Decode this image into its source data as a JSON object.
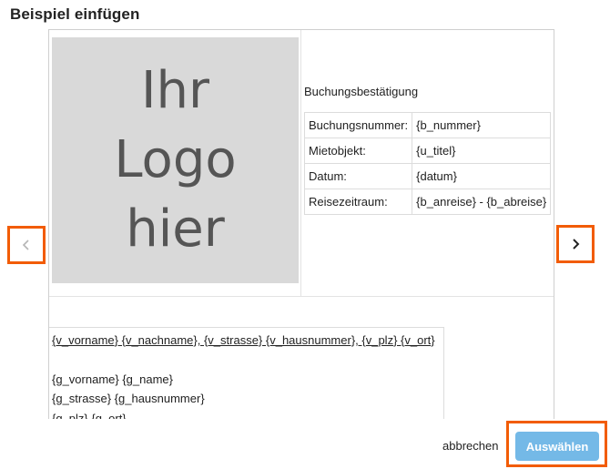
{
  "dialog": {
    "title": "Beispiel einfügen"
  },
  "template": {
    "logo_lines": [
      "Ihr",
      "Logo",
      "hier"
    ],
    "heading": "Buchungsbestätigung",
    "rows": [
      {
        "label": "Buchungsnummer:",
        "value": "{b_nummer}"
      },
      {
        "label": "Mietobjekt:",
        "value": "{u_titel}"
      },
      {
        "label": "Datum:",
        "value": "{datum}"
      },
      {
        "label": "Reisezeitraum:",
        "value": "{b_anreise} - {b_abreise}"
      }
    ],
    "address": {
      "sender_line": "{v_vorname} {v_nachname}, {v_strasse} {v_hausnummer}, {v_plz} {v_ort}",
      "guest_lines": [
        "{g_vorname} {g_name}",
        "{g_strasse} {g_hausnummer}",
        "{g_plz} {g_ort}"
      ]
    }
  },
  "navigation": {
    "prev_icon": "chevron-left-icon",
    "next_icon": "chevron-right-icon"
  },
  "footer": {
    "cancel_label": "abbrechen",
    "select_label": "Auswählen"
  },
  "colors": {
    "highlight": "#f25c05",
    "primary_button": "#74b9e7",
    "logo_placeholder": "#d9d9d9"
  }
}
